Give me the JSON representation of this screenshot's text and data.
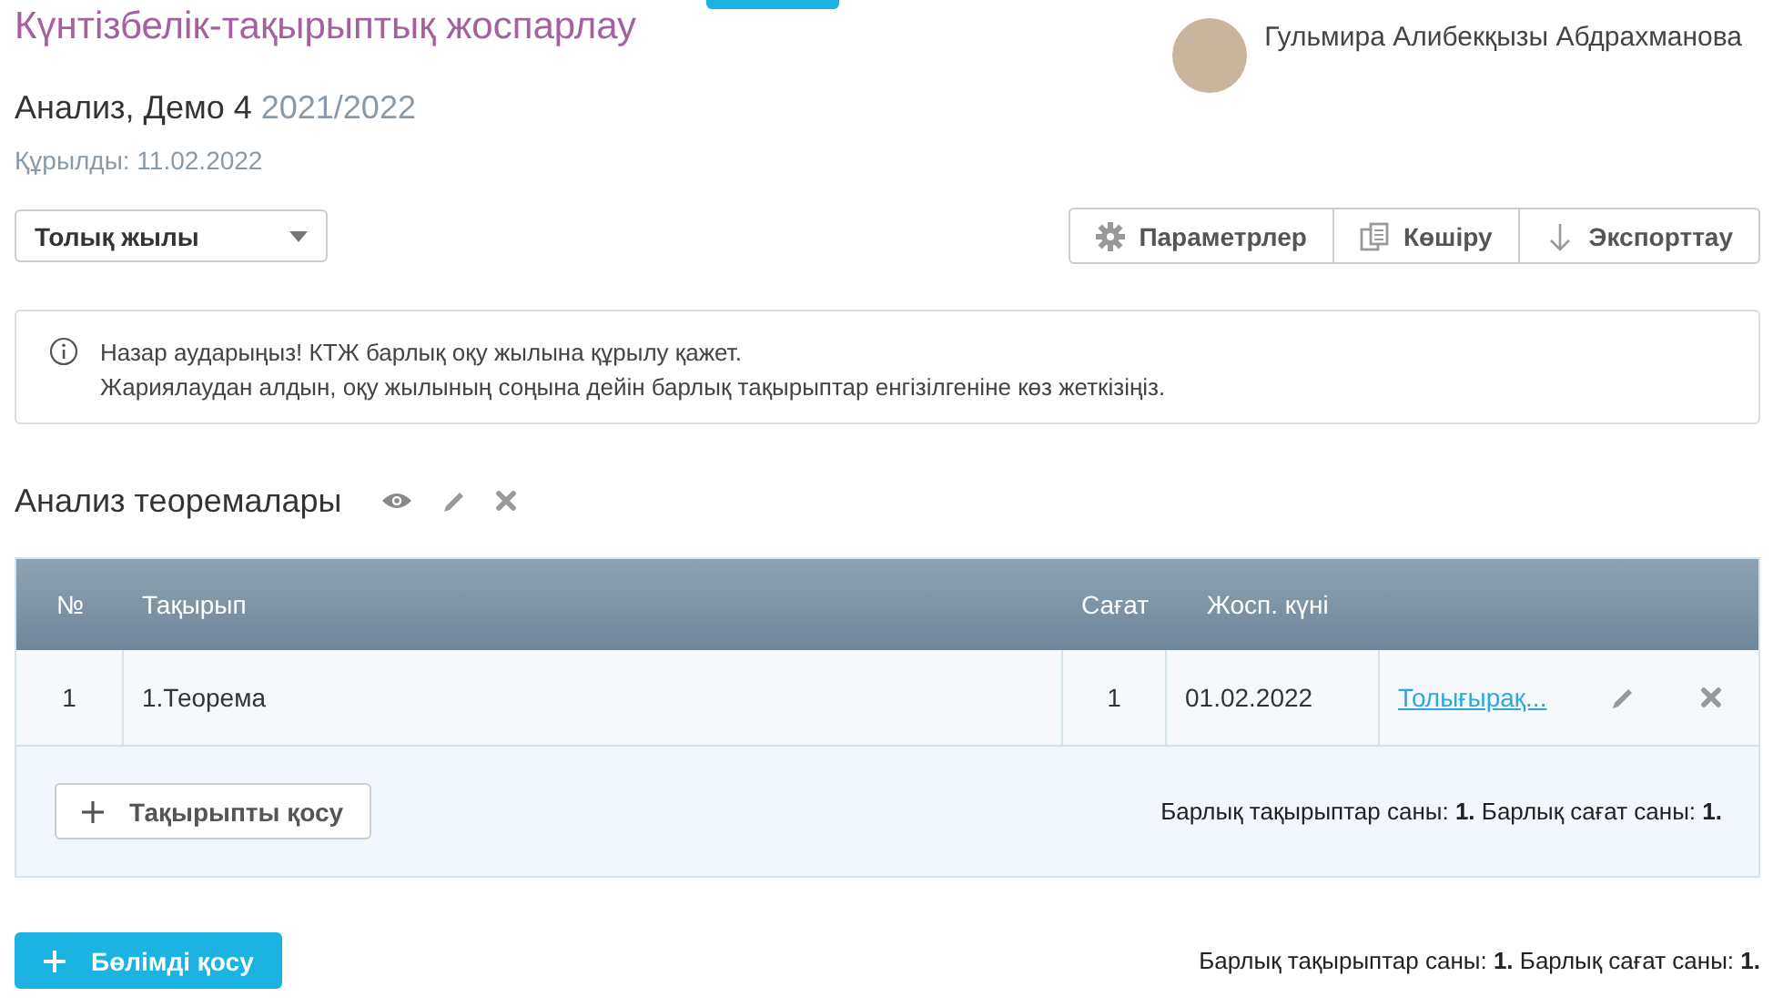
{
  "header": {
    "title": "Күнтізбелік-тақырыптық жоспарлау",
    "user": "Гульмира Алибекқызы Абдрахманова"
  },
  "plan": {
    "name": "Анализ, Демо 4",
    "year": "2021/2022",
    "created": "Құрылды: 11.02.2022"
  },
  "period_select": {
    "value": "Толық жылы"
  },
  "toolbar": [
    {
      "kind": "gear",
      "label": "Параметрлер"
    },
    {
      "kind": "copy",
      "label": "Көшіру"
    },
    {
      "kind": "download",
      "label": "Экспорттау"
    }
  ],
  "alert": {
    "lines": [
      "Назар аударыңыз! КТЖ барлық оқу жылына құрылу қажет.",
      "Жариялаудан алдын, оқу жылының соңына дейін барлық тақырыптар енгізілгеніне көз жеткізіңіз."
    ]
  },
  "section": {
    "title": "Анализ теоремалары",
    "table": {
      "columns": [
        "№",
        "Тақырып",
        "Сағат",
        "Жосп. күні"
      ],
      "rows": [
        {
          "number": "1",
          "topic": "1.Теорема",
          "hours": "1",
          "date": "01.02.2022",
          "link": "Толығырақ..."
        }
      ]
    },
    "add_button": "Тақырыпты қосу",
    "summary": "Барлық тақырыптар саны: **1.** Барлық сағат саны: **1.**"
  },
  "add_section_button": "Бөлімді қосу",
  "total_summary": "Барлық тақырыптар саны: **1.** Барлық сағат саны: **1.**"
}
